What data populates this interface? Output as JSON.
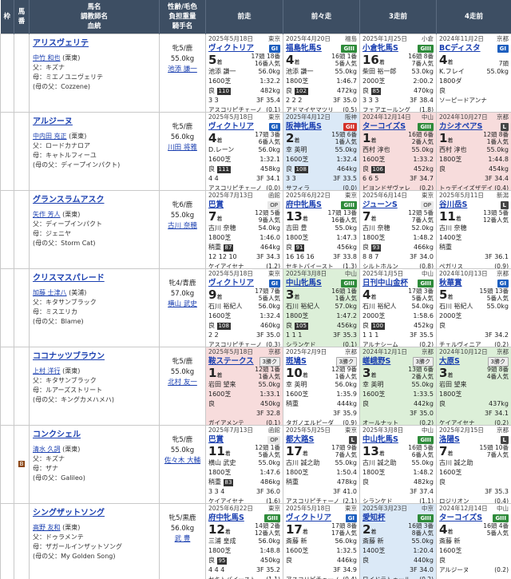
{
  "headers": {
    "waku": "枠",
    "uma": "馬番",
    "horse": "馬名\n調教師名\n血統",
    "info": "性齢/毛色\n負担重量\n騎手名",
    "r1": "前走",
    "r2": "前々走",
    "r3": "3走前",
    "r4": "4走前"
  },
  "horses": [
    {
      "name": "アリスヴェリテ",
      "trainer": "中竹 和也",
      "region": "(栗東)",
      "sire": "父：キズナ",
      "dam": "母：ミエノユニヴェリテ",
      "bms": "(母の父：Cozzene)",
      "sexage": "牝5/鹿",
      "weight": "55.0kg",
      "jockey": "池添 謙一",
      "mark": "",
      "races": [
        {
          "bg": "g",
          "date": "2025年5月18日",
          "place": "東京",
          "race": "ヴィクトリア",
          "grade": "GI",
          "gc": "g1",
          "rank": "5",
          "heads": "17頭 18番\n16番人気",
          "jockey": "池添 謙一",
          "kg": "56.0kg",
          "dist": "1600芝",
          "time": "1:32.2",
          "going": "良",
          "pop": "110",
          "bw": "482kg",
          "pos": "3 3",
          "f3": "3F 35.4",
          "winner": "アスコリピチェーノ",
          "diff": "(0.1)"
        },
        {
          "bg": "g",
          "date": "2025年4月20日",
          "place": "福島",
          "race": "福島牝馬S",
          "grade": "GIII",
          "gc": "g3",
          "rank": "4",
          "heads": "16頭 1番\n5番人気",
          "jockey": "池添 謙一",
          "kg": "55.0kg",
          "dist": "1800芝",
          "time": "1:46.7",
          "going": "良",
          "pop": "102",
          "bw": "472kg",
          "pos": "2 2 2",
          "f3": "3F 35.0",
          "winner": "アドマイヤマツリ",
          "diff": "(0.5)"
        },
        {
          "bg": "g",
          "date": "2025年1月25日",
          "place": "小倉",
          "race": "小倉牝馬S",
          "grade": "GIII",
          "gc": "g3",
          "rank": "16",
          "heads": "16頭 8番\n7番人気",
          "jockey": "柴田 裕一郎",
          "kg": "53.0kg",
          "dist": "2000芝",
          "time": "2:00.2",
          "going": "良",
          "pop": "85",
          "bw": "470kg",
          "pos": "3 3 3",
          "f3": "3F 38.4",
          "winner": "フェアエールング",
          "diff": "(1.8)"
        },
        {
          "bg": "g",
          "date": "2024年11月2日",
          "place": "京都",
          "race": "BCディスタ",
          "grade": "GI",
          "gc": "g1",
          "rank": "4",
          "heads": "7頭\n",
          "jockey": "K.フレイ",
          "kg": "55.0kg",
          "dist": "1800ダ",
          "time": "",
          "going": "良",
          "pop": "",
          "bw": "",
          "pos": "",
          "f3": "",
          "winner": "ソーピードアンナ",
          "diff": ""
        }
      ]
    },
    {
      "name": "アルジーヌ",
      "trainer": "中内田 充正",
      "region": "(栗東)",
      "sire": "父：ロードカナロア",
      "dam": "母：キャトルフィーユ",
      "bms": "(母の父：ディープインパクト)",
      "sexage": "牝5/鹿",
      "weight": "56.0kg",
      "jockey": "川田 将雅",
      "mark": "",
      "races": [
        {
          "bg": "g",
          "date": "2025年5月18日",
          "place": "東京",
          "race": "ヴィクトリア",
          "grade": "GI",
          "gc": "g1",
          "rank": "4",
          "heads": "17頭 3番\n6番人気",
          "jockey": "D.レーン",
          "kg": "56.0kg",
          "dist": "1600芝",
          "time": "1:32.1",
          "going": "良",
          "pop": "111",
          "bw": "458kg",
          "pos": "4 4",
          "f3": "3F 34.1",
          "winner": "アスコリピチェーノ",
          "diff": "(0.0)"
        },
        {
          "bg": "blue",
          "date": "2025年4月12日",
          "place": "阪神",
          "race": "阪神牝馬S",
          "grade": "GII",
          "gc": "g2",
          "rank": "2",
          "heads": "15頭 6番\n1番人気",
          "jockey": "幸 英明",
          "kg": "55.0kg",
          "dist": "1600芝",
          "time": "1:32.4",
          "going": "良",
          "pop": "108",
          "bw": "464kg",
          "pos": "3 3",
          "f3": "3F 33.5",
          "winner": "サフィラ",
          "diff": "(0.0)"
        },
        {
          "bg": "red",
          "date": "2024年12月14日",
          "place": "中山",
          "race": "ターコイズS",
          "grade": "GIII",
          "gc": "g3",
          "rank": "1",
          "heads": "16頭 6番\n2番人気",
          "jockey": "西村 淳也",
          "kg": "55.0kg",
          "dist": "1600芝",
          "time": "1:33.2",
          "going": "良",
          "pop": "106",
          "bw": "452kg",
          "pos": "6 6 5",
          "f3": "3F 34.7",
          "winner": "ビヨンドザヴァレ",
          "diff": "(0.2)"
        },
        {
          "bg": "red",
          "date": "2024年10月27日",
          "place": "京都",
          "race": "カシオペアS",
          "grade": "L",
          "gc": "gl",
          "rank": "1",
          "heads": "12頭 8番\n1番人気",
          "jockey": "西村 淳也",
          "kg": "55.0kg",
          "dist": "1800芝",
          "time": "1:44.8",
          "going": "良",
          "pop": "",
          "bw": "454kg",
          "pos": "",
          "f3": "3F 34.4",
          "winner": "トゥデイイズザデイ",
          "diff": "(0.4)"
        }
      ]
    },
    {
      "name": "グランスラムアスク",
      "trainer": "矢作 芳人",
      "region": "(栗東)",
      "sire": "父：ディープインパクト",
      "dam": "母：ジェニヤ",
      "bms": "(母の父：Storm Cat)",
      "sexage": "牝6/鹿",
      "weight": "55.0kg",
      "jockey": "古川 奈穂",
      "mark": "",
      "races": [
        {
          "bg": "g",
          "date": "2025年7月13日",
          "place": "函館",
          "race": "巴賞",
          "grade": "OP",
          "gc": "gop",
          "rank": "7",
          "heads": "12頭 5番\n9番人気",
          "jockey": "古川 奈穂",
          "kg": "54.0kg",
          "dist": "1800芝",
          "time": "1:46.0",
          "going": "稍重",
          "pop": "87",
          "bw": "464kg",
          "pos": "12 12 10",
          "f3": "3F 34.3",
          "winner": "ケイアイセナ",
          "diff": "(1.2)"
        },
        {
          "bg": "g",
          "date": "2025年6月22日",
          "place": "東京",
          "race": "府中牝馬S",
          "grade": "GIII",
          "gc": "g3",
          "rank": "13",
          "heads": "17頭 13番\n16番人気",
          "jockey": "吉田 豊",
          "kg": "55.0kg",
          "dist": "1800芝",
          "time": "1:47.3",
          "going": "良",
          "pop": "91",
          "bw": "456kg",
          "pos": "16 16 16",
          "f3": "3F 33.8",
          "winner": "セキトバイースト",
          "diff": "(1.3)"
        },
        {
          "bg": "g",
          "date": "2025年6月14日",
          "place": "東京",
          "race": "ジューンS",
          "grade": "OP",
          "gc": "gop",
          "rank": "7",
          "heads": "12頭 5番\n7番人気",
          "jockey": "古川 奈穂",
          "kg": "52.0kg",
          "dist": "1800芝",
          "time": "1:48.2",
          "going": "良",
          "pop": "93",
          "bw": "466kg",
          "pos": "8 8 7",
          "f3": "3F 34.0",
          "winner": "シルトホルン",
          "diff": "(0.8)"
        },
        {
          "bg": "g",
          "date": "2025年5月11日",
          "place": "新潟",
          "race": "谷川岳S",
          "grade": "L",
          "gc": "gl",
          "rank": "11",
          "heads": "13頭 5番\n12番人気",
          "jockey": "古川 奈穂",
          "kg": "",
          "dist": "1400芝",
          "time": "",
          "going": "稍重",
          "pop": "",
          "bw": "",
          "pos": "",
          "f3": "3F 36.1",
          "winner": "ペガリス",
          "diff": "(0.9)"
        }
      ]
    },
    {
      "name": "クリスマスパレード",
      "trainer": "加藤 士津八",
      "region": "(美浦)",
      "sire": "父：キタサンブラック",
      "dam": "母：ミスエリカ",
      "bms": "(母の父：Blame)",
      "sexage": "牝4/青鹿",
      "weight": "57.0kg",
      "jockey": "横山 武史",
      "mark": "",
      "races": [
        {
          "bg": "g",
          "date": "2025年5月18日",
          "place": "東京",
          "race": "ヴィクトリア",
          "grade": "GI",
          "gc": "g1",
          "rank": "9",
          "heads": "17頭 7番\n5番人気",
          "jockey": "石川 裕紀人",
          "kg": "56.0kg",
          "dist": "1600芝",
          "time": "1:32.4",
          "going": "良",
          "pop": "108",
          "bw": "460kg",
          "pos": "2 2",
          "f3": "3F 35.0",
          "winner": "アスコリピチェーノ",
          "diff": "(0.3)"
        },
        {
          "bg": "green",
          "date": "2025年3月8日",
          "place": "中山",
          "race": "中山牝馬S",
          "grade": "GIII",
          "gc": "g3",
          "rank": "3",
          "heads": "16頭 1番\n1番人気",
          "jockey": "石川 裕紀人",
          "kg": "57.0kg",
          "dist": "1800芝",
          "time": "1:47.2",
          "going": "良",
          "pop": "105",
          "bw": "456kg",
          "pos": "1 1 1",
          "f3": "3F 35.3",
          "winner": "シランケド",
          "diff": "(0.1)"
        },
        {
          "bg": "g",
          "date": "2025年1月5日",
          "place": "中山",
          "race": "日刊中山金杯",
          "grade": "GIII",
          "gc": "g3",
          "rank": "4",
          "heads": "17頭 3番\n5番人気",
          "jockey": "石川 裕紀人",
          "kg": "54.0kg",
          "dist": "2000芝",
          "time": "1:58.6",
          "going": "良",
          "pop": "100",
          "bw": "452kg",
          "pos": "1 1 1",
          "f3": "3F 35.5",
          "winner": "アルナシーム",
          "diff": "(0.2)"
        },
        {
          "bg": "g",
          "date": "2024年10月13日",
          "place": "京都",
          "race": "秋華賞",
          "grade": "GI",
          "gc": "g1",
          "rank": "5",
          "heads": "15頭 13番\n5番人気",
          "jockey": "石川 裕紀人",
          "kg": "55.0kg",
          "dist": "2000芝",
          "time": "",
          "going": "良",
          "pop": "",
          "bw": "",
          "pos": "",
          "f3": "3F 34.2",
          "winner": "チェルヴィニア",
          "diff": "(0.2)"
        }
      ]
    },
    {
      "name": "ココナッツブラウン",
      "trainer": "上村 洋行",
      "region": "(栗東)",
      "sire": "父：キタサンブラック",
      "dam": "母：ルアーズストリート",
      "bms": "(母の父：キングカメハメハ)",
      "sexage": "牝5/鹿",
      "weight": "55.0kg",
      "jockey": "北村 友一",
      "mark": "",
      "races": [
        {
          "bg": "red",
          "date": "2025年5月18日",
          "place": "京都",
          "race": "鞍ステークス",
          "grade": "3勝ク",
          "gc": "g3k",
          "rank": "1",
          "heads": "12頭 1番\n1番人気",
          "jockey": "岩田 望来",
          "kg": "55.0kg",
          "dist": "1600芝",
          "time": "1:33.1",
          "going": "良",
          "pop": "",
          "bw": "450kg",
          "pos": "",
          "f3": "3F 32.8",
          "winner": "ガイアメンテ",
          "diff": "(0.1)"
        },
        {
          "bg": "g",
          "date": "2025年2月9日",
          "place": "京都",
          "race": "斑鳩S",
          "grade": "3勝ク",
          "gc": "g3k",
          "rank": "10",
          "heads": "12頭 9番\n1番人気",
          "jockey": "幸 英明",
          "kg": "56.0kg",
          "dist": "1600芝",
          "time": "1:35.9",
          "going": "稍重",
          "pop": "",
          "bw": "444kg",
          "pos": "",
          "f3": "3F 35.9",
          "winner": "タガノエルピーダ",
          "diff": "(0.9)"
        },
        {
          "bg": "green",
          "date": "2024年12月1日",
          "place": "京都",
          "race": "嵯峨野S",
          "grade": "3勝ク",
          "gc": "g3k",
          "rank": "3",
          "heads": "13頭 6番\n2番人気",
          "jockey": "幸 英明",
          "kg": "55.0kg",
          "dist": "1600芝",
          "time": "1:33.5",
          "going": "良",
          "pop": "",
          "bw": "442kg",
          "pos": "",
          "f3": "3F 35.0",
          "winner": "オールナット",
          "diff": "(0.2)"
        },
        {
          "bg": "green",
          "date": "2024年10月12日",
          "place": "京都",
          "race": "大原S",
          "grade": "3勝ク",
          "gc": "g3k",
          "rank": "3",
          "heads": "9頭 8番\n4番人気",
          "jockey": "岩田 望来",
          "kg": "",
          "dist": "1800芝",
          "time": "",
          "going": "良",
          "pop": "",
          "bw": "437kg",
          "pos": "",
          "f3": "3F 34.1",
          "winner": "ケイアイセナ",
          "diff": "(0.2)"
        }
      ]
    },
    {
      "name": "コンクシェル",
      "trainer": "清水 久詞",
      "region": "(栗東)",
      "sire": "父：キズナ",
      "dam": "母：ザナ",
      "bms": "(母の父：Galileo)",
      "sexage": "牝5/鹿",
      "weight": "55.0kg",
      "jockey": "佐々木 大輔",
      "mark": "B",
      "races": [
        {
          "bg": "g",
          "date": "2025年7月13日",
          "place": "函館",
          "race": "巴賞",
          "grade": "OP",
          "gc": "gop",
          "rank": "11",
          "heads": "12頭 1番\n5番人気",
          "jockey": "横山 武史",
          "kg": "55.0kg",
          "dist": "1800芝",
          "time": "1:47.6",
          "going": "稍重",
          "pop": "83",
          "bw": "486kg",
          "pos": "3 3 4",
          "f3": "3F 36.0",
          "winner": "ケイアイセナ",
          "diff": "(1.6)"
        },
        {
          "bg": "g",
          "date": "2025年5月25日",
          "place": "東京",
          "race": "都大路S",
          "grade": "L",
          "gc": "gl",
          "rank": "17",
          "heads": "17頭 9番\n7番人気",
          "jockey": "古川 誠之助",
          "kg": "55.0kg",
          "dist": "1800芝",
          "time": "1:50.4",
          "going": "稍重",
          "pop": "",
          "bw": "478kg",
          "pos": "",
          "f3": "3F 41.0",
          "winner": "アスコリピチェーノ",
          "diff": "(2.1)"
        },
        {
          "bg": "g",
          "date": "2025年3月8日",
          "place": "中山",
          "race": "中山牝馬S",
          "grade": "GIII",
          "gc": "g3",
          "rank": "13",
          "heads": "16頭 5番\n6番人気",
          "jockey": "古川 誠之助",
          "kg": "55.0kg",
          "dist": "1800芝",
          "time": "1:48.2",
          "going": "良",
          "pop": "",
          "bw": "482kg",
          "pos": "",
          "f3": "3F 37.4",
          "winner": "シランケド",
          "diff": "(1.1)"
        },
        {
          "bg": "g",
          "date": "2025年2月15日",
          "place": "京都",
          "race": "洛陽S",
          "grade": "L",
          "gc": "gl",
          "rank": "7",
          "heads": "15頭 10番\n7番人気",
          "jockey": "古川 誠之助",
          "kg": "",
          "dist": "1600芝",
          "time": "",
          "going": "良",
          "pop": "",
          "bw": "",
          "pos": "",
          "f3": "3F 35.3",
          "winner": "ロジリオン",
          "diff": "(0.4)"
        }
      ]
    },
    {
      "name": "シングザットソング",
      "trainer": "高野 友和",
      "region": "(栗東)",
      "sire": "父：ドゥラメンテ",
      "dam": "母：ザガールインザットソング",
      "bms": "(母の父：My Golden Song)",
      "sexage": "牝5/黒鹿",
      "weight": "56.0kg",
      "jockey": "武 豊",
      "mark": "",
      "races": [
        {
          "bg": "g",
          "date": "2025年6月22日",
          "place": "東京",
          "race": "府中牝馬S",
          "grade": "GIII",
          "gc": "g3",
          "rank": "12",
          "heads": "14頭 2番\n12番人気",
          "jockey": "三浦 皇成",
          "kg": "56.0kg",
          "dist": "1800芝",
          "time": "1:48.8",
          "going": "良",
          "pop": "95",
          "bw": "450kg",
          "pos": "4 4 4",
          "f3": "3F 35.2",
          "winner": "セキトバイースト",
          "diff": "(1.1)"
        },
        {
          "bg": "g",
          "date": "2025年5月18日",
          "place": "東京",
          "race": "ヴィクトリア",
          "grade": "GI",
          "gc": "g1",
          "rank": "17",
          "heads": "17頭 8番\n17番人気",
          "jockey": "斎藤 新",
          "kg": "56.0kg",
          "dist": "1600芝",
          "time": "1:32.5",
          "going": "良",
          "pop": "",
          "bw": "446kg",
          "pos": "",
          "f3": "3F 34.9",
          "winner": "アスコリピチェーノ",
          "diff": "(0.4)"
        },
        {
          "bg": "blue",
          "date": "2025年3月23日",
          "place": "中京",
          "race": "愛知杯",
          "grade": "GIII",
          "gc": "g3",
          "rank": "2",
          "heads": "16頭 3番\n8番人気",
          "jockey": "斎藤 新",
          "kg": "55.0kg",
          "dist": "1400芝",
          "time": "1:20.4",
          "going": "良",
          "pop": "",
          "bw": "440kg",
          "pos": "",
          "f3": "3F 34.0",
          "winner": "ワイドラトゥール",
          "diff": "(0.2)"
        },
        {
          "bg": "g",
          "date": "2024年12月14日",
          "place": "中山",
          "race": "ターコイズS",
          "grade": "GIII",
          "gc": "g3",
          "rank": "4",
          "heads": "16頭 4番\n5番人気",
          "jockey": "斎藤 新",
          "kg": "",
          "dist": "1600芝",
          "time": "",
          "going": "良",
          "pop": "",
          "bw": "",
          "pos": "",
          "f3": "",
          "winner": "アルジーヌ",
          "diff": "(0.2)"
        }
      ]
    }
  ]
}
